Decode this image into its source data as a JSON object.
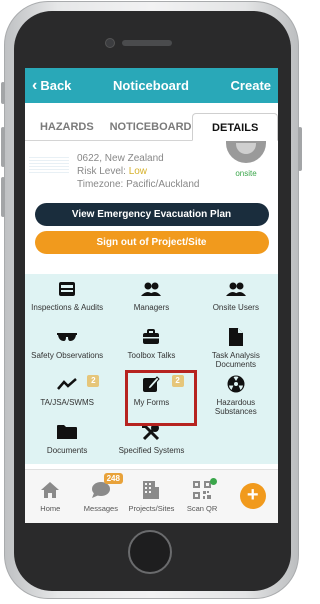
{
  "navbar": {
    "back_label": "Back",
    "title": "Noticeboard",
    "create_label": "Create"
  },
  "tabs": [
    {
      "label": "HAZARDS"
    },
    {
      "label": "NOTICEBOARD"
    },
    {
      "label": "DETAILS"
    }
  ],
  "site": {
    "address": "0622, New Zealand",
    "risk_label": "Risk Level: ",
    "risk_value": "Low",
    "timezone": "Timezone: Pacific/Auckland",
    "status": "onsite"
  },
  "buttons": {
    "evacuation": "View Emergency Evacuation Plan",
    "signout": "Sign out of Project/Site"
  },
  "grid": [
    {
      "label": "Inspections & Audits",
      "icon": "inbox-icon"
    },
    {
      "label": "Managers",
      "icon": "users-icon"
    },
    {
      "label": "Onsite Users",
      "icon": "users-icon"
    },
    {
      "label": "Safety Observations",
      "icon": "glasses-icon"
    },
    {
      "label": "Toolbox Talks",
      "icon": "briefcase-icon"
    },
    {
      "label": "Task Analysis Documents",
      "icon": "document-icon"
    },
    {
      "label": "TA/JSA/SWMS",
      "icon": "chart-line-icon",
      "badge": "2"
    },
    {
      "label": "My Forms",
      "icon": "edit-form-icon",
      "badge": "2"
    },
    {
      "label": "Hazardous Substances",
      "icon": "radiation-icon"
    },
    {
      "label": "Documents",
      "icon": "folder-icon"
    },
    {
      "label": "Specified Systems",
      "icon": "tools-icon"
    }
  ],
  "tabbar": [
    {
      "label": "Home",
      "icon": "home-icon"
    },
    {
      "label": "Messages",
      "icon": "chat-icon",
      "badge": "248"
    },
    {
      "label": "Projects/Sites",
      "icon": "building-icon"
    },
    {
      "label": "Scan QR",
      "icon": "qr-icon"
    },
    {
      "label": "",
      "icon": "plus-icon"
    }
  ],
  "colors": {
    "nav": "#29a8b8",
    "dark_button": "#1a2d3d",
    "orange": "#f19a1d",
    "grid_bg": "#dff3f3",
    "highlight": "#b62320"
  }
}
